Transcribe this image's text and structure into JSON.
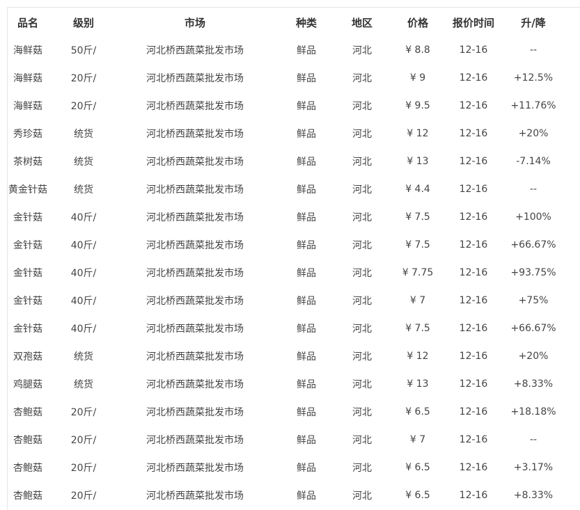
{
  "table": {
    "headers": [
      "品名",
      "级别",
      "市场",
      "种类",
      "地区",
      "价格",
      "报价时间",
      "升/降"
    ],
    "rows": [
      {
        "name": "海鲜菇",
        "grade": "50斤/",
        "market": "河北桥西蔬菜批发市场",
        "type": "鲜品",
        "region": "河北",
        "price": "¥ 8.8",
        "date": "12-16",
        "change": "--"
      },
      {
        "name": "海鲜菇",
        "grade": "20斤/",
        "market": "河北桥西蔬菜批发市场",
        "type": "鲜品",
        "region": "河北",
        "price": "¥ 9",
        "date": "12-16",
        "change": "+12.5%"
      },
      {
        "name": "海鲜菇",
        "grade": "20斤/",
        "market": "河北桥西蔬菜批发市场",
        "type": "鲜品",
        "region": "河北",
        "price": "¥ 9.5",
        "date": "12-16",
        "change": "+11.76%"
      },
      {
        "name": "秀珍菇",
        "grade": "统货",
        "market": "河北桥西蔬菜批发市场",
        "type": "鲜品",
        "region": "河北",
        "price": "¥ 12",
        "date": "12-16",
        "change": "+20%"
      },
      {
        "name": "茶树菇",
        "grade": "统货",
        "market": "河北桥西蔬菜批发市场",
        "type": "鲜品",
        "region": "河北",
        "price": "¥ 13",
        "date": "12-16",
        "change": "-7.14%"
      },
      {
        "name": "黄金针菇",
        "grade": "统货",
        "market": "河北桥西蔬菜批发市场",
        "type": "鲜品",
        "region": "河北",
        "price": "¥ 4.4",
        "date": "12-16",
        "change": "--"
      },
      {
        "name": "金针菇",
        "grade": "40斤/",
        "market": "河北桥西蔬菜批发市场",
        "type": "鲜品",
        "region": "河北",
        "price": "¥ 7.5",
        "date": "12-16",
        "change": "+100%"
      },
      {
        "name": "金针菇",
        "grade": "40斤/",
        "market": "河北桥西蔬菜批发市场",
        "type": "鲜品",
        "region": "河北",
        "price": "¥ 7.5",
        "date": "12-16",
        "change": "+66.67%"
      },
      {
        "name": "金针菇",
        "grade": "40斤/",
        "market": "河北桥西蔬菜批发市场",
        "type": "鲜品",
        "region": "河北",
        "price": "¥ 7.75",
        "date": "12-16",
        "change": "+93.75%"
      },
      {
        "name": "金针菇",
        "grade": "40斤/",
        "market": "河北桥西蔬菜批发市场",
        "type": "鲜品",
        "region": "河北",
        "price": "¥ 7",
        "date": "12-16",
        "change": "+75%"
      },
      {
        "name": "金针菇",
        "grade": "40斤/",
        "market": "河北桥西蔬菜批发市场",
        "type": "鲜品",
        "region": "河北",
        "price": "¥ 7.5",
        "date": "12-16",
        "change": "+66.67%"
      },
      {
        "name": "双孢菇",
        "grade": "统货",
        "market": "河北桥西蔬菜批发市场",
        "type": "鲜品",
        "region": "河北",
        "price": "¥ 12",
        "date": "12-16",
        "change": "+20%"
      },
      {
        "name": "鸡腿菇",
        "grade": "统货",
        "market": "河北桥西蔬菜批发市场",
        "type": "鲜品",
        "region": "河北",
        "price": "¥ 13",
        "date": "12-16",
        "change": "+8.33%"
      },
      {
        "name": "杏鲍菇",
        "grade": "20斤/",
        "market": "河北桥西蔬菜批发市场",
        "type": "鲜品",
        "region": "河北",
        "price": "¥ 6.5",
        "date": "12-16",
        "change": "+18.18%"
      },
      {
        "name": "杏鲍菇",
        "grade": "20斤/",
        "market": "河北桥西蔬菜批发市场",
        "type": "鲜品",
        "region": "河北",
        "price": "¥ 7",
        "date": "12-16",
        "change": "--"
      },
      {
        "name": "杏鲍菇",
        "grade": "20斤/",
        "market": "河北桥西蔬菜批发市场",
        "type": "鲜品",
        "region": "河北",
        "price": "¥ 6.5",
        "date": "12-16",
        "change": "+3.17%"
      },
      {
        "name": "杏鲍菇",
        "grade": "20斤/",
        "market": "河北桥西蔬菜批发市场",
        "type": "鲜品",
        "region": "河北",
        "price": "¥ 6.5",
        "date": "12-16",
        "change": "+8.33%"
      }
    ]
  }
}
